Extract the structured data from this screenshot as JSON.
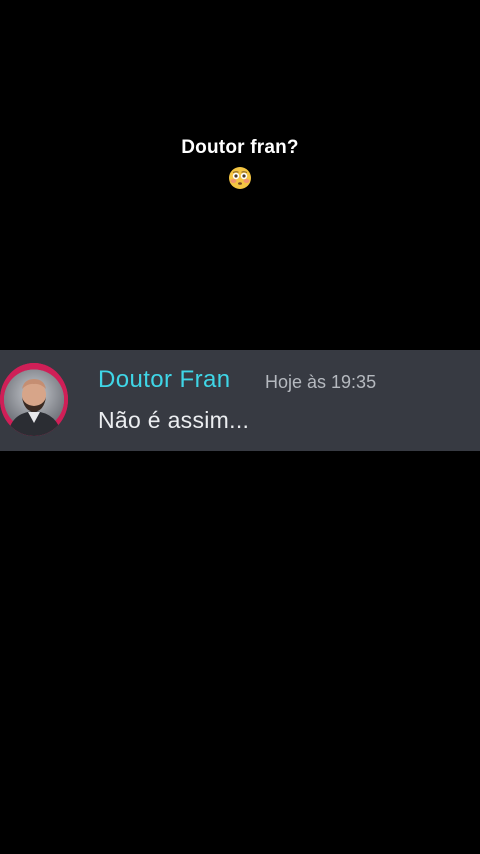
{
  "caption": {
    "text": "Doutor fran?",
    "emoji": "flushed-face-emoji"
  },
  "message": {
    "avatar_icon": "user-avatar",
    "username": "Doutor Fran",
    "timestamp": "Hoje às 19:35",
    "text": "Não é assim..."
  },
  "colors": {
    "background": "#000000",
    "message_background": "#373a42",
    "username": "#3fd6e7",
    "timestamp": "#b5b9bf",
    "avatar_ring": "#cf1f57"
  }
}
